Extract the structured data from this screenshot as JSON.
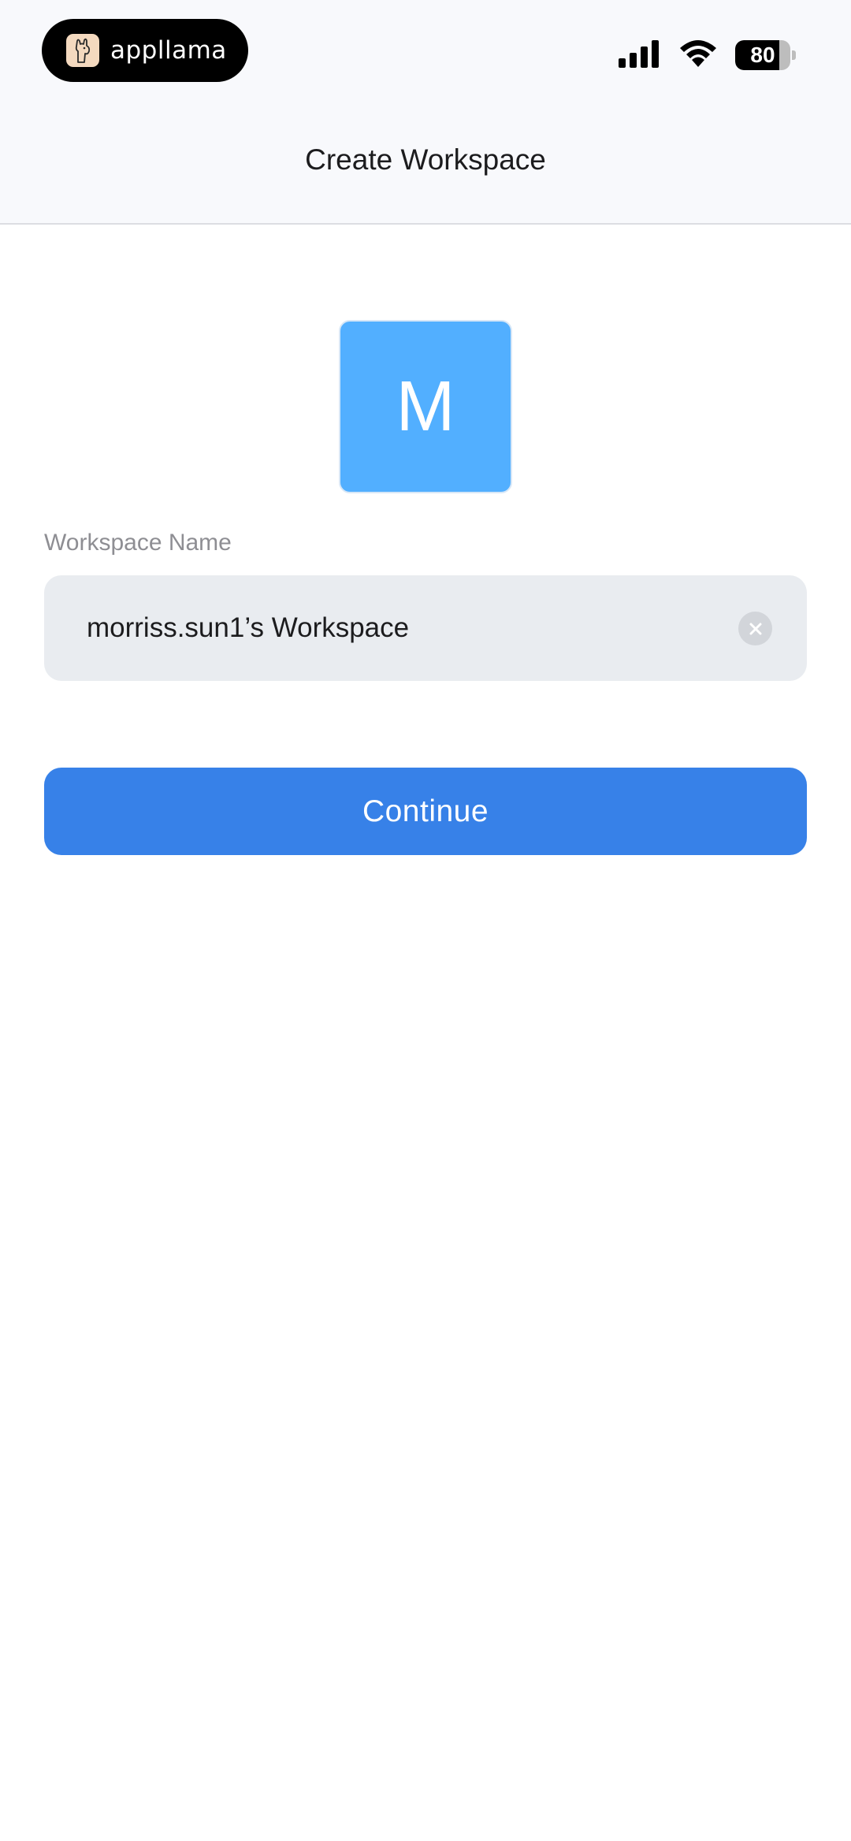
{
  "status_bar": {
    "app_badge": "appllama",
    "battery_level": "80",
    "battery_percent": 80
  },
  "header": {
    "title": "Create Workspace"
  },
  "avatar": {
    "initial": "M",
    "color": "#52afff"
  },
  "form": {
    "name_label": "Workspace Name",
    "name_value": "morriss.sun1’s Workspace"
  },
  "actions": {
    "continue_label": "Continue",
    "accent": "#3781e8"
  },
  "icons": [
    "llama-logo-icon",
    "cellular-signal-icon",
    "wifi-icon",
    "battery-icon",
    "clear-icon"
  ]
}
